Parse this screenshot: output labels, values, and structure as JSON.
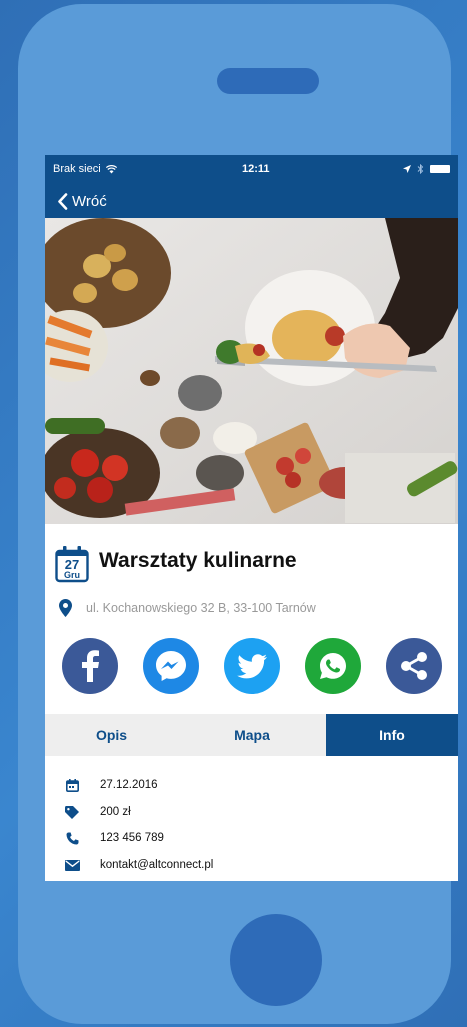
{
  "status_bar": {
    "carrier": "Brak sieci",
    "time": "12:11"
  },
  "nav": {
    "back_label": "Wróć"
  },
  "event": {
    "day": "27",
    "month": "Gru",
    "title": "Warsztaty kulinarne",
    "address": "ul. Kochanowskiego 32 B, 33-100 Tarnów"
  },
  "share_buttons": [
    {
      "network": "facebook",
      "icon": "facebook-icon",
      "color": "#3b5998"
    },
    {
      "network": "messenger",
      "icon": "messenger-icon",
      "color": "#1e88e5"
    },
    {
      "network": "twitter",
      "icon": "twitter-icon",
      "color": "#1da1f2"
    },
    {
      "network": "whatsapp",
      "icon": "whatsapp-icon",
      "color": "#1fa83a"
    },
    {
      "network": "share",
      "icon": "share-icon",
      "color": "#3b5998"
    }
  ],
  "tabs": [
    {
      "label": "Opis",
      "active": false
    },
    {
      "label": "Mapa",
      "active": false
    },
    {
      "label": "Info",
      "active": true
    }
  ],
  "info": {
    "date": "27.12.2016",
    "price": "200 zł",
    "phone": "123 456 789",
    "email": "kontakt@altconnect.pl"
  },
  "colors": {
    "primary": "#0e4e8a",
    "phone_body": "#5a9bd8",
    "background": "#2f6fb6"
  }
}
